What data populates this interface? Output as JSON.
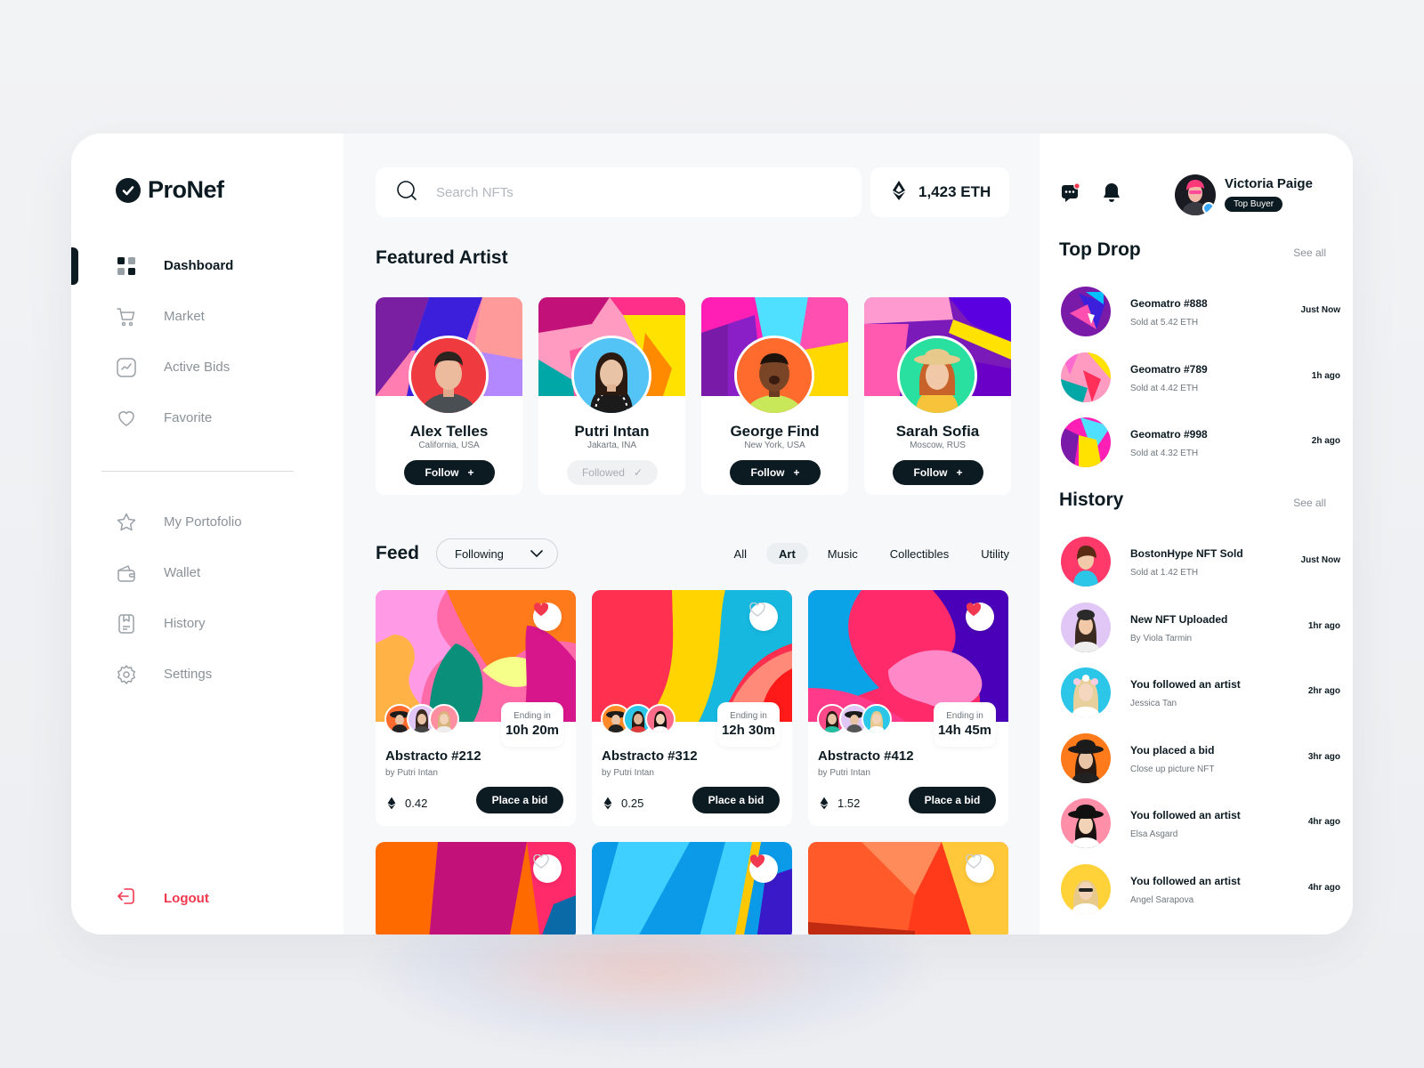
{
  "brand": {
    "name": "ProNef"
  },
  "sidebar": {
    "items": [
      {
        "label": "Dashboard",
        "icon": "dashboard-icon",
        "active": true
      },
      {
        "label": "Market",
        "icon": "cart-icon"
      },
      {
        "label": "Active Bids",
        "icon": "chart-icon"
      },
      {
        "label": "Favorite",
        "icon": "heart-icon"
      }
    ],
    "items2": [
      {
        "label": "My Portofolio",
        "icon": "star-icon"
      },
      {
        "label": "Wallet",
        "icon": "wallet-icon"
      },
      {
        "label": "History",
        "icon": "history-icon"
      },
      {
        "label": "Settings",
        "icon": "gear-icon"
      }
    ],
    "logout": "Logout"
  },
  "search": {
    "placeholder": "Search NFTs"
  },
  "balance": {
    "value": "1,423 ETH"
  },
  "featured": {
    "title": "Featured Artist",
    "artists": [
      {
        "name": "Alex Telles",
        "location": "California, USA",
        "button": "Follow",
        "followed": false
      },
      {
        "name": "Putri Intan",
        "location": "Jakarta, INA",
        "button": "Followed",
        "followed": true
      },
      {
        "name": "George Find",
        "location": "New York, USA",
        "button": "Follow",
        "followed": false
      },
      {
        "name": "Sarah Sofia",
        "location": "Moscow, RUS",
        "button": "Follow",
        "followed": false
      }
    ]
  },
  "feed": {
    "title": "Feed",
    "filter": "Following",
    "tabs": [
      "All",
      "Art",
      "Music",
      "Collectibles",
      "Utility"
    ],
    "active_tab": "Art",
    "items": [
      {
        "title": "Abstracto #212",
        "by": "by Putri Intan",
        "price": "0.42",
        "ending_label": "Ending in",
        "ending": "10h 20m",
        "bid": "Place a bid",
        "liked": true
      },
      {
        "title": "Abstracto #312",
        "by": "by Putri Intan",
        "price": "0.25",
        "ending_label": "Ending in",
        "ending": "12h 30m",
        "bid": "Place a bid",
        "liked": false
      },
      {
        "title": "Abstracto #412",
        "by": "by Putri Intan",
        "price": "1.52",
        "ending_label": "Ending in",
        "ending": "14h 45m",
        "bid": "Place a bid",
        "liked": true
      }
    ],
    "second_row_liked": [
      false,
      true,
      false
    ]
  },
  "user": {
    "name": "Victoria Paige",
    "badge": "Top Buyer"
  },
  "top_drop": {
    "title": "Top Drop",
    "see_all": "See all",
    "items": [
      {
        "name": "Geomatro #888",
        "sub": "Sold at 5.42 ETH",
        "time": "Just Now"
      },
      {
        "name": "Geomatro #789",
        "sub": "Sold at 4.42 ETH",
        "time": "1h ago"
      },
      {
        "name": "Geomatro #998",
        "sub": "Sold at 4.32 ETH",
        "time": "2h ago"
      }
    ]
  },
  "history": {
    "title": "History",
    "see_all": "See all",
    "items": [
      {
        "name": "BostonHype NFT Sold",
        "sub": "Sold at 1.42 ETH",
        "time": "Just Now"
      },
      {
        "name": "New NFT Uploaded",
        "sub": "By Viola Tarmin",
        "time": "1hr ago"
      },
      {
        "name": "You followed an artist",
        "sub": "Jessica Tan",
        "time": "2hr ago"
      },
      {
        "name": "You placed a bid",
        "sub": "Close up picture NFT",
        "time": "3hr ago"
      },
      {
        "name": "You followed an artist",
        "sub": "Elsa Asgard",
        "time": "4hr ago"
      },
      {
        "name": "You followed an artist",
        "sub": "Angel Sarapova",
        "time": "4hr ago"
      }
    ]
  },
  "colors": {
    "ink": "#0c1a22",
    "accent_red": "#f2384f",
    "bg": "#f7f8f9"
  }
}
